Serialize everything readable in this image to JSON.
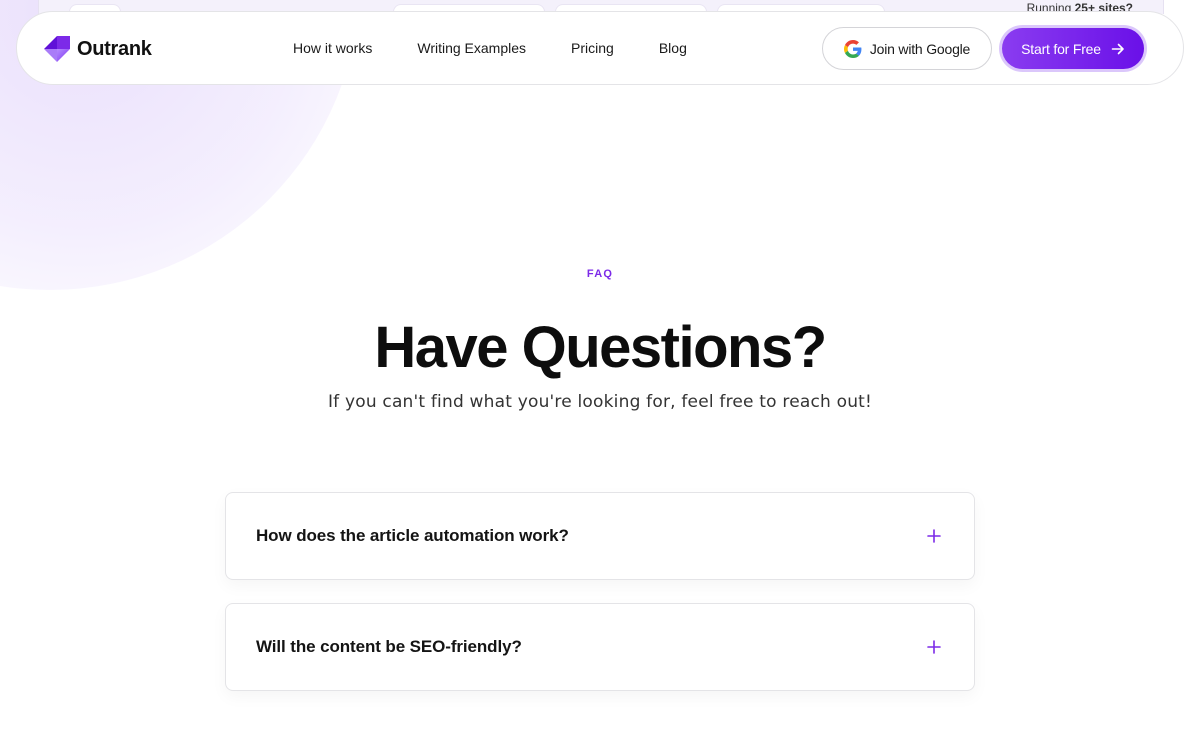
{
  "behind_bar": {
    "text_prefix": "Running ",
    "text_bold": "25+ sites?"
  },
  "nav": {
    "logo_text": "Outrank",
    "links": [
      {
        "label": "How it works"
      },
      {
        "label": "Writing Examples"
      },
      {
        "label": "Pricing"
      },
      {
        "label": "Blog"
      }
    ],
    "google_button_label": "Join with Google",
    "start_button_label": "Start for Free"
  },
  "faq": {
    "eyebrow": "FAQ",
    "title": "Have Questions?",
    "subtitle": "If you can't find what you're looking for, feel free to reach out!",
    "items": [
      {
        "question": "How does the article automation work?"
      },
      {
        "question": "Will the content be SEO-friendly?"
      }
    ]
  },
  "colors": {
    "accent": "#7c2ae8",
    "button_gradient_start": "#8a3cf0",
    "button_gradient_end": "#6a10e8",
    "button_ring": "#dbc7fb",
    "text": "#111111",
    "border": "#e4e4e7"
  },
  "icons": {
    "logo": "outrank-logo-icon",
    "google": "google-g-icon",
    "arrow": "arrow-right-icon",
    "toggle": "plus-icon"
  }
}
